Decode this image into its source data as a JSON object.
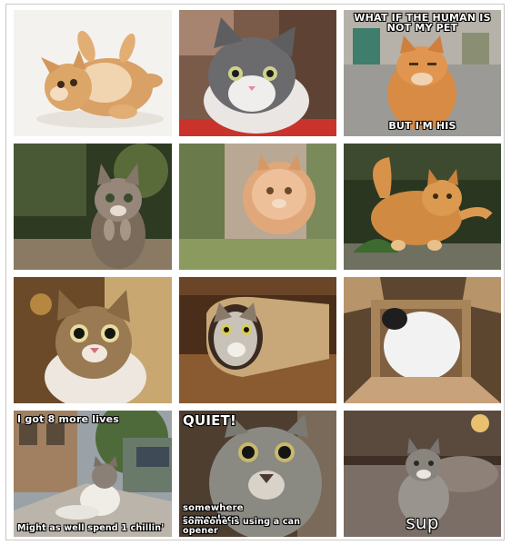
{
  "tiles": [
    {
      "id": "tile-1",
      "subject": "kitten rolling on back"
    },
    {
      "id": "tile-2",
      "subject": "grey and white kitten"
    },
    {
      "id": "tile-3",
      "subject": "orange cat meme",
      "caption_top": "WHAT IF THE HUMAN IS NOT MY PET",
      "caption_bottom": "BUT I'M HIS"
    },
    {
      "id": "tile-4",
      "subject": "tabby kitten standing up"
    },
    {
      "id": "tile-5",
      "subject": "fluffy cat leaping"
    },
    {
      "id": "tile-6",
      "subject": "orange cat waving paw"
    },
    {
      "id": "tile-7",
      "subject": "surprised tabby cat"
    },
    {
      "id": "tile-8",
      "subject": "cat in paper bag"
    },
    {
      "id": "tile-9",
      "subject": "white cat in cardboard box"
    },
    {
      "id": "tile-10",
      "subject": "cat lounging on sidewalk meme",
      "caption_top": "I got 8 more lives",
      "caption_bottom": "Might as well spend 1 chillin'"
    },
    {
      "id": "tile-11",
      "subject": "close up cat meme",
      "caption_top": "QUIET!",
      "caption_bottom_lines": [
        "somewhere",
        "someplace",
        "someone is using a can opener"
      ]
    },
    {
      "id": "tile-12",
      "subject": "tabby cat on couch meme",
      "caption_bottom": "sup"
    }
  ],
  "colors": {
    "frame_border": "#c8c8c8",
    "background": "#ffffff",
    "caption_text": "#ffffff",
    "caption_outline": "#000000"
  }
}
